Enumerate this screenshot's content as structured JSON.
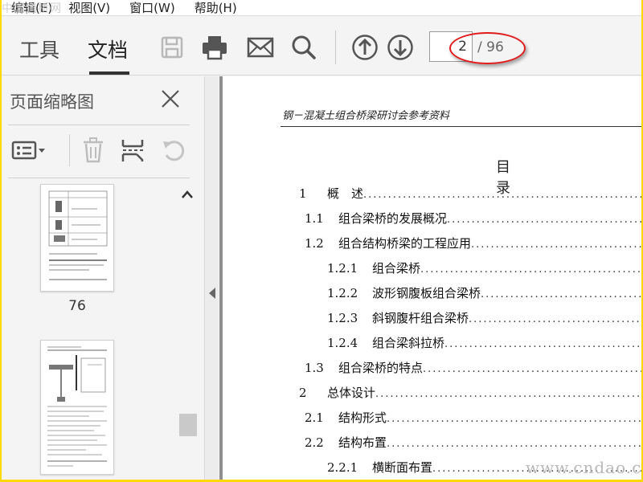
{
  "menubar": {
    "items": [
      "编辑(E)",
      "视图(V)",
      "窗口(W)",
      "帮助(H)"
    ]
  },
  "watermarks": {
    "top_left": "中国道桥网",
    "bottom_right": "www.cndao.com"
  },
  "toolbar": {
    "tabs": [
      "工具",
      "文档"
    ],
    "active_tab": "文档",
    "icons": [
      "save-icon",
      "print-icon",
      "email-icon",
      "search-icon",
      "page-up-icon",
      "page-down-icon"
    ],
    "current_page": "2",
    "total_pages": "/ 96",
    "highlight_color": "#e11b1b"
  },
  "sidebar": {
    "title": "页面缩略图",
    "tools": [
      "options-icon",
      "delete-icon",
      "extract-icon",
      "rotate-icon"
    ],
    "thumbnails": [
      {
        "label": "76"
      },
      {
        "label": ""
      }
    ]
  },
  "document": {
    "header": "钢－混凝土组合桥梁研讨会参考资料",
    "toc_title": "目 录",
    "toc": [
      {
        "num": "1",
        "text": "概　述",
        "level": 1
      },
      {
        "num": "1.1",
        "text": "组合梁桥的发展概况",
        "level": 2
      },
      {
        "num": "1.2",
        "text": "组合结构桥梁的工程应用",
        "level": 2
      },
      {
        "num": "1.2.1",
        "text": "组合梁桥",
        "level": 3
      },
      {
        "num": "1.2.2",
        "text": "波形钢腹板组合梁桥",
        "level": 3
      },
      {
        "num": "1.2.3",
        "text": "斜钢腹杆组合梁桥",
        "level": 3
      },
      {
        "num": "1.2.4",
        "text": "组合梁斜拉桥",
        "level": 3
      },
      {
        "num": "1.3",
        "text": "组合梁桥的特点",
        "level": 2
      },
      {
        "num": "2",
        "text": "总体设计",
        "level": 1
      },
      {
        "num": "2.1",
        "text": "结构形式",
        "level": 2
      },
      {
        "num": "2.2",
        "text": "结构布置",
        "level": 2
      },
      {
        "num": "2.2.1",
        "text": "横断面布置",
        "level": 3
      }
    ]
  }
}
